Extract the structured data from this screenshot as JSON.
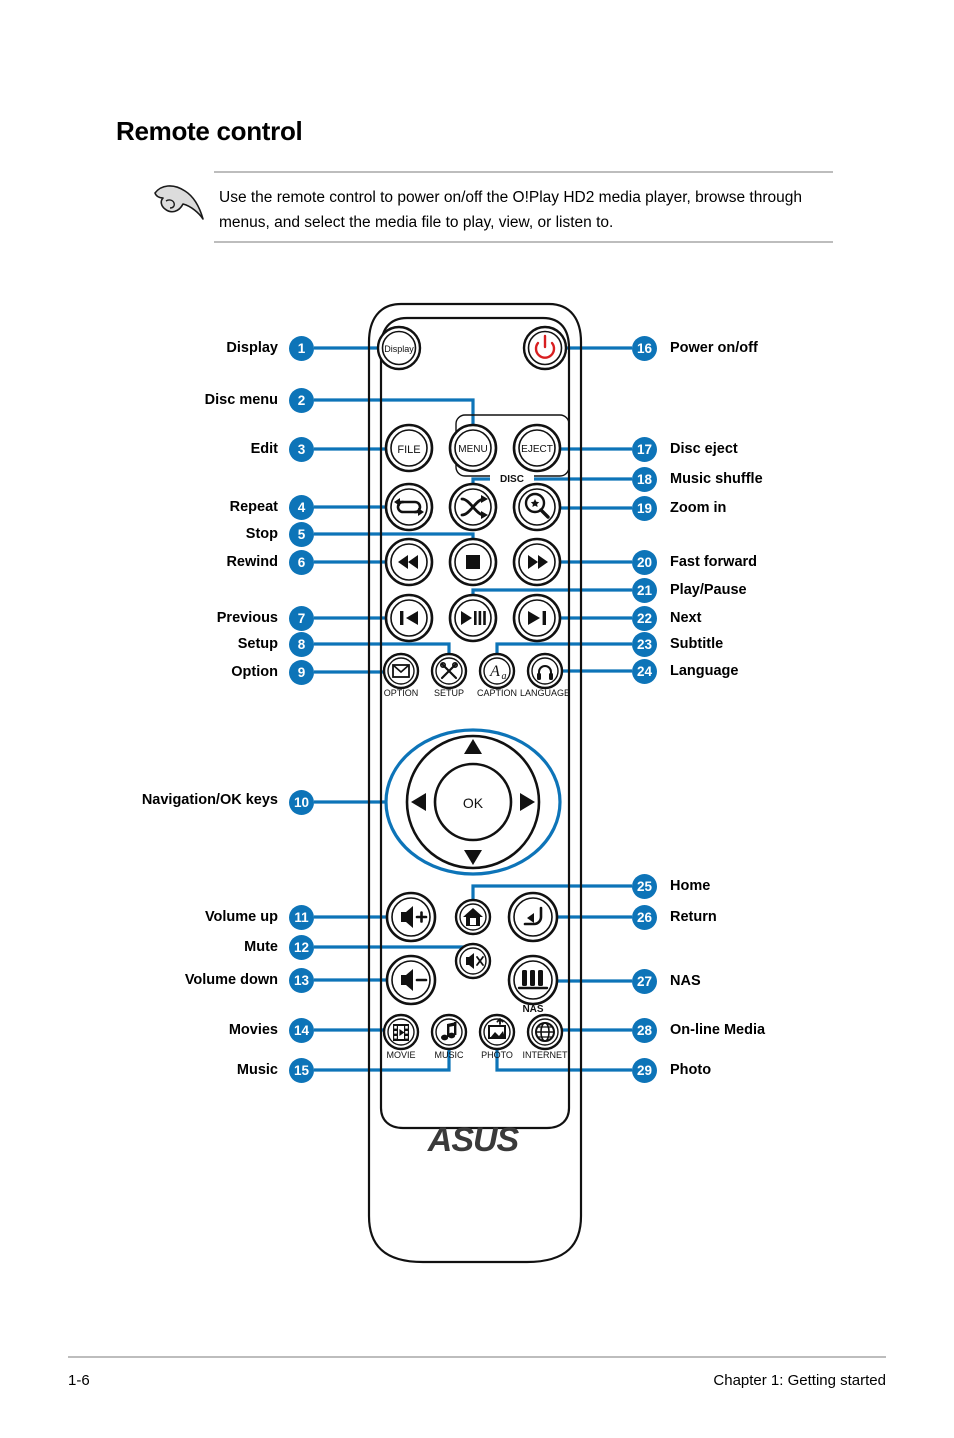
{
  "page": {
    "title": "Remote control",
    "note": {
      "icon": "pointing-hand-icon",
      "text": "Use the remote control to power on/off the O!Play HD2 media player, browse through menus, and select the media file to play, view, or listen to."
    },
    "footer": {
      "page_number": "1-6",
      "chapter": "Chapter 1:  Getting started"
    }
  },
  "colors": {
    "badge_blue": "#0d74b8",
    "leader_blue": "#0d74b8",
    "power_red": "#d81e20",
    "rule_gray": "#bdbdbd",
    "outline_black": "#000000"
  },
  "remote": {
    "brand": "ASUS",
    "group_label": "DISC",
    "button_captions": {
      "display": "Display",
      "file": "FILE",
      "menu": "MENU",
      "eject": "EJECT",
      "ok": "OK",
      "play_pause": "▶/II",
      "option": "OPTION",
      "setup": "SETUP",
      "caption": "CAPTION",
      "language": "LANGUAGE",
      "nas": "NAS",
      "movie": "MOVIE",
      "music": "MUSIC",
      "photo": "PHOTO",
      "internet": "INTERNET"
    }
  },
  "callouts": {
    "left": [
      {
        "num": "1",
        "label": "Display"
      },
      {
        "num": "2",
        "label": "Disc menu"
      },
      {
        "num": "3",
        "label": "Edit"
      },
      {
        "num": "4",
        "label": "Repeat"
      },
      {
        "num": "5",
        "label": "Stop"
      },
      {
        "num": "6",
        "label": "Rewind"
      },
      {
        "num": "7",
        "label": "Previous"
      },
      {
        "num": "8",
        "label": "Setup"
      },
      {
        "num": "9",
        "label": "Option"
      },
      {
        "num": "10",
        "label": "Navigation/OK keys"
      },
      {
        "num": "11",
        "label": "Volume up"
      },
      {
        "num": "12",
        "label": "Mute"
      },
      {
        "num": "13",
        "label": "Volume down"
      },
      {
        "num": "14",
        "label": "Movies"
      },
      {
        "num": "15",
        "label": "Music"
      }
    ],
    "right": [
      {
        "num": "16",
        "label": "Power on/off"
      },
      {
        "num": "17",
        "label": "Disc eject"
      },
      {
        "num": "18",
        "label": "Music shuffle"
      },
      {
        "num": "19",
        "label": "Zoom in"
      },
      {
        "num": "20",
        "label": "Fast forward"
      },
      {
        "num": "21",
        "label": "Play/Pause"
      },
      {
        "num": "22",
        "label": "Next"
      },
      {
        "num": "23",
        "label": "Subtitle"
      },
      {
        "num": "24",
        "label": "Language"
      },
      {
        "num": "25",
        "label": "Home"
      },
      {
        "num": "26",
        "label": "Return"
      },
      {
        "num": "27",
        "label": "NAS"
      },
      {
        "num": "28",
        "label": "On-line Media"
      },
      {
        "num": "29",
        "label": "Photo"
      }
    ]
  }
}
